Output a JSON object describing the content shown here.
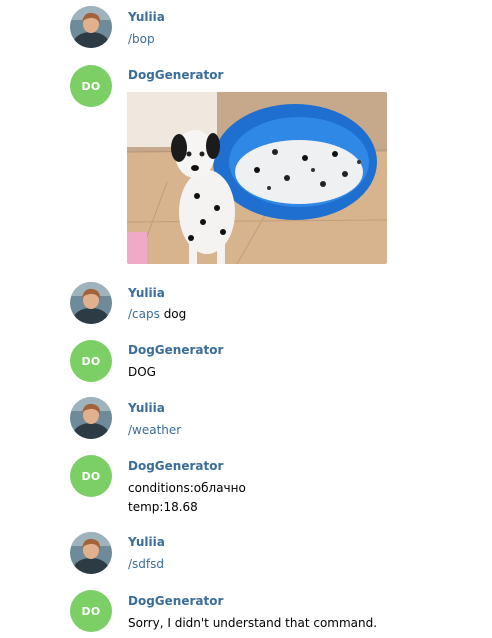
{
  "users": {
    "user": {
      "name": "Yuliia"
    },
    "bot": {
      "name": "DogGenerator",
      "initials": "DO"
    }
  },
  "messages": {
    "m1": {
      "text": "/bop"
    },
    "m2": {
      "image": "dalmatian-with-puppies-photo"
    },
    "m3": {
      "command": "/caps",
      "rest": " dog"
    },
    "m4": {
      "text": "DOG"
    },
    "m5": {
      "text": "/weather"
    },
    "m6": {
      "line1": "conditions:облачно",
      "line2": "temp:18.68"
    },
    "m7": {
      "text": "/sdfsd"
    },
    "m8": {
      "text": "Sorry, I didn't understand that command."
    }
  },
  "colors": {
    "link": "#3a6d99",
    "bot_avatar": "#7bcf65",
    "text": "#000000",
    "background": "#ffffff"
  }
}
